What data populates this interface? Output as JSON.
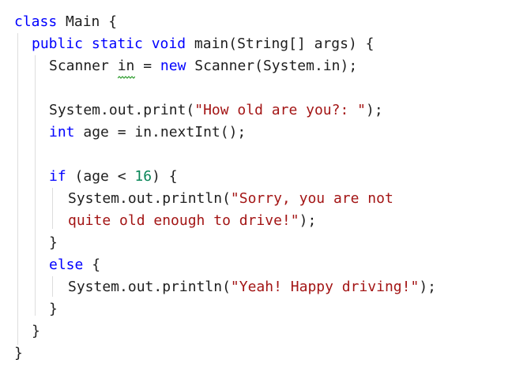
{
  "code": {
    "l1": {
      "kw": "class",
      "rest": " Main {"
    },
    "l2": {
      "kw": "public static void",
      "rest": " main(String[] args) {"
    },
    "l3": {
      "a": "Scanner ",
      "var": "in",
      "b": " = ",
      "kw": "new",
      "c": " Scanner(System.in);"
    },
    "l5": {
      "a": "System.out.print(",
      "str": "\"How old are you?: \"",
      "b": ");"
    },
    "l6": {
      "kw": "int",
      "rest": " age = in.nextInt();"
    },
    "l8": {
      "kw": "if",
      "a": " (age < ",
      "num": "16",
      "b": ") {"
    },
    "l9": {
      "a": "System.out.println(",
      "str": "\"Sorry, you are not"
    },
    "l10": {
      "str": "quite old enough to drive!\"",
      "b": ");"
    },
    "l11": {
      "text": "}"
    },
    "l12": {
      "kw": "else",
      "rest": " {"
    },
    "l13": {
      "a": "System.out.println(",
      "str": "\"Yeah! Happy driving!\"",
      "b": ");"
    },
    "l14": {
      "text": "}"
    },
    "l15": {
      "text": "}"
    },
    "l16": {
      "text": "}"
    }
  },
  "colors": {
    "keyword": "#0000ff",
    "string": "#a31515",
    "number": "#098658",
    "text": "#1e1e1e",
    "indent_guide": "#dddddd",
    "squiggle": "#2e9d2e"
  }
}
